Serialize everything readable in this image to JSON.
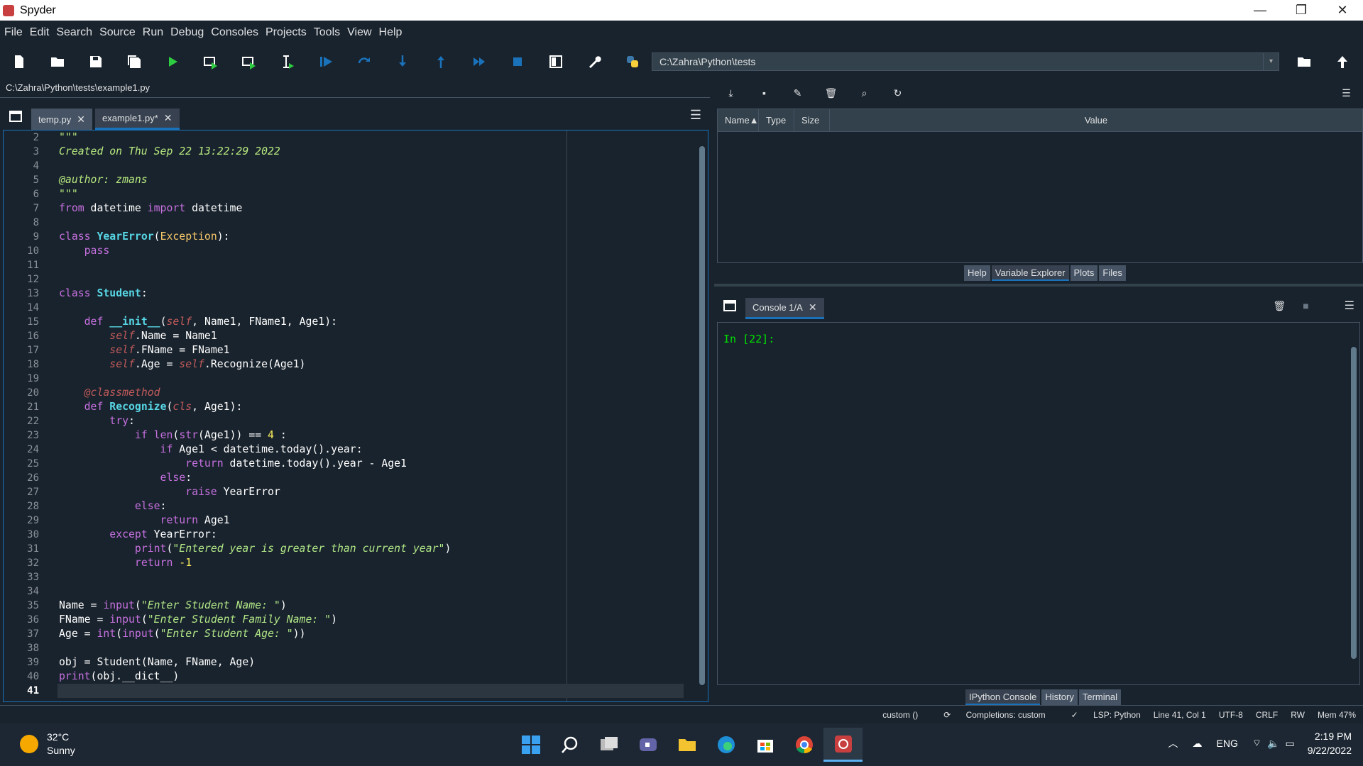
{
  "window": {
    "title": "Spyder",
    "minimize": "—",
    "restore": "❐",
    "close": "✕"
  },
  "menu": [
    "File",
    "Edit",
    "Search",
    "Source",
    "Run",
    "Debug",
    "Consoles",
    "Projects",
    "Tools",
    "View",
    "Help"
  ],
  "toolbar": {
    "path": "C:\\Zahra\\Python\\tests",
    "path_dropdown": "▾"
  },
  "editor": {
    "file_path": "C:\\Zahra\\Python\\tests\\example1.py",
    "tabs": [
      {
        "label": "temp.py",
        "close": "✕"
      },
      {
        "label": "example1.py*",
        "close": "✕"
      }
    ],
    "current_line": 41
  },
  "variable_explorer": {
    "columns": [
      "Name",
      "Type",
      "Size",
      "Value"
    ],
    "sort_indicator": "▲",
    "pane_tabs": [
      "Help",
      "Variable Explorer",
      "Plots",
      "Files"
    ]
  },
  "console": {
    "tab": {
      "label": "Console 1/A",
      "close": "✕"
    },
    "prompt": "In [22]:",
    "pane_tabs": [
      "IPython Console",
      "History",
      "Terminal"
    ]
  },
  "statusbar": {
    "conda": "custom ()",
    "completions": "Completions: custom",
    "lsp": "LSP: Python",
    "position": "Line 41, Col 1",
    "encoding": "UTF-8",
    "eol": "CRLF",
    "rw": "RW",
    "mem": "Mem 47%"
  },
  "taskbar": {
    "temperature": "32°C",
    "weather": "Sunny",
    "lang": "ENG",
    "time": "2:19 PM",
    "date": "9/22/2022"
  },
  "colors": {
    "bg": "#19232d",
    "accent": "#1a72bb",
    "prompt": "#00e000"
  }
}
